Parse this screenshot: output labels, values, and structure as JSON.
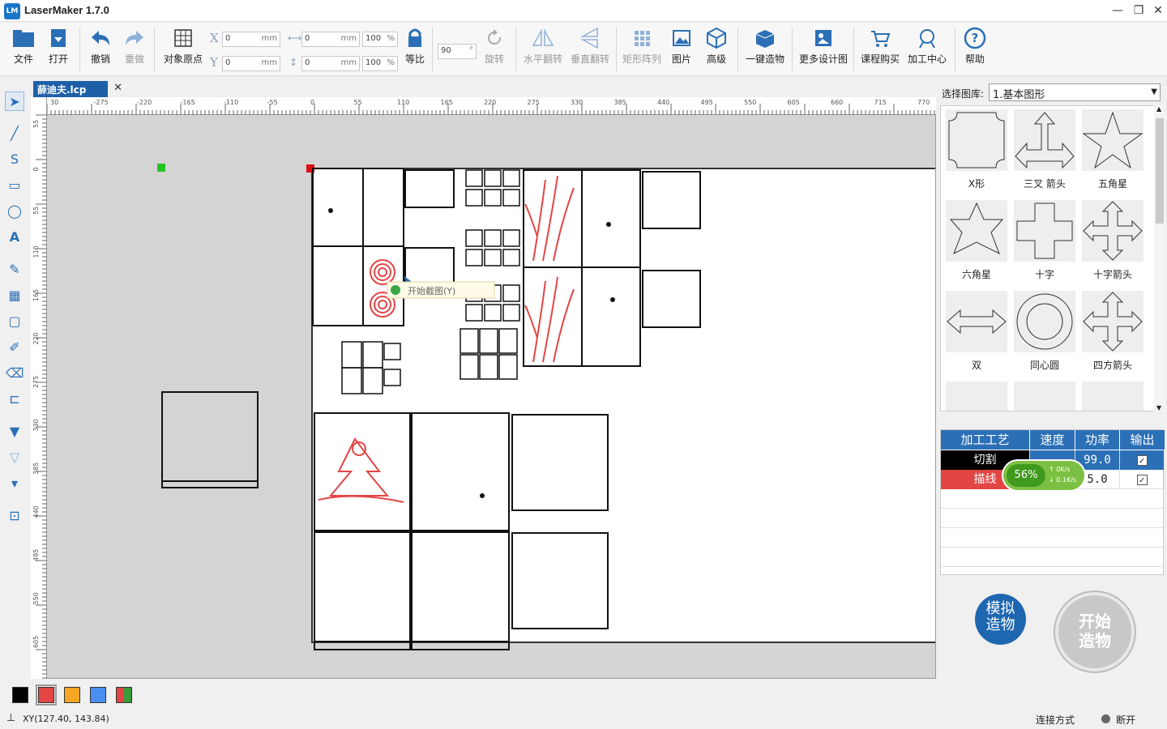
{
  "app": {
    "title": "LaserMaker 1.7.0",
    "logo_text": "LM"
  },
  "toolbar": {
    "file": "文件",
    "open": "打开",
    "undo": "撤销",
    "redo": "重做",
    "origin": "对象原点",
    "x_label": "X",
    "y_label": "Y",
    "x_value": "0",
    "y_value": "0",
    "unit": "mm",
    "w_value": "0",
    "h_value": "0",
    "w_pct": "100",
    "h_pct": "100",
    "pct_unit": "%",
    "ratio": "等比",
    "rotate_value": "90",
    "rotate": "旋转",
    "hflip": "水平翻转",
    "vflip": "垂直翻转",
    "array": "矩形阵列",
    "image": "图片",
    "advanced": "高级",
    "oneclick": "一键造物",
    "moredesign": "更多设计图",
    "course": "课程购买",
    "center": "加工中心",
    "help": "帮助"
  },
  "tab": {
    "name": "薛迪夫.lcp",
    "close": "✕"
  },
  "ruler": {
    "h_ticks": [
      "30",
      "-275",
      "-220",
      "-165",
      "-110",
      "-55",
      "0",
      "55",
      "110",
      "165",
      "220",
      "275",
      "330",
      "385",
      "440",
      "495",
      "550",
      "605",
      "660",
      "715",
      "770"
    ],
    "v_ticks": [
      "55",
      "0",
      "55",
      "110",
      "165",
      "220",
      "275",
      "330",
      "385",
      "440",
      "495",
      "550",
      "605"
    ]
  },
  "canvas": {
    "tooltip": "开始截图(Y)"
  },
  "library": {
    "label": "选择图库:",
    "selected": "1.基本图形",
    "shapes": [
      "X形",
      "三叉 箭头",
      "五角星",
      "六角星",
      "十字",
      "十字箭头",
      "双",
      "同心圆",
      "四方箭头"
    ]
  },
  "process": {
    "headers": [
      "加工工艺",
      "速度",
      "功率",
      "输出"
    ],
    "rows": [
      {
        "name": "切割",
        "speed": "",
        "power": "99.0",
        "output": "✓",
        "color": "#000000"
      },
      {
        "name": "描线",
        "speed": "",
        "power": "5.0",
        "output": "✓",
        "color": "#e34545"
      }
    ]
  },
  "monitor": {
    "percent": "56%",
    "up": "0K/s",
    "down": "0.1K/s"
  },
  "actions": {
    "simulate_line1": "模拟",
    "simulate_line2": "造物",
    "start_line1": "开始",
    "start_line2": "造物"
  },
  "palette": {
    "colors": [
      "#000000",
      "#e34545",
      "#f5a623",
      "#4a8ff0"
    ]
  },
  "status": {
    "coords": "XY(127.40, 143.84)",
    "connect": "连接方式",
    "state": "断开"
  }
}
